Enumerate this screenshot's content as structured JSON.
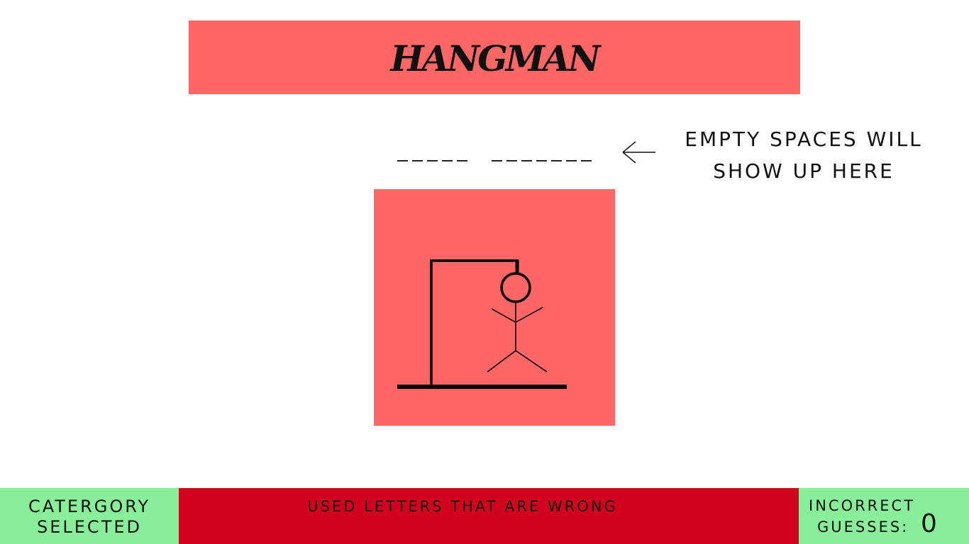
{
  "title": "HANGMAN",
  "word": {
    "groups": [
      5,
      7
    ]
  },
  "hint": {
    "line1": "EMPTY SPACES WILL",
    "line2": "SHOW UP HERE"
  },
  "footer": {
    "category_line1": "CATERGORY",
    "category_line2": "SELECTED",
    "used_letters_label": "USED LETTERS THAT ARE WRONG",
    "incorrect_line1": "INCORRECT",
    "incorrect_line2": "GUESSES:",
    "incorrect_count": "0"
  },
  "colors": {
    "banner": "#ff6666",
    "used_bar": "#d2001e",
    "side_panels": "#88ee99"
  }
}
